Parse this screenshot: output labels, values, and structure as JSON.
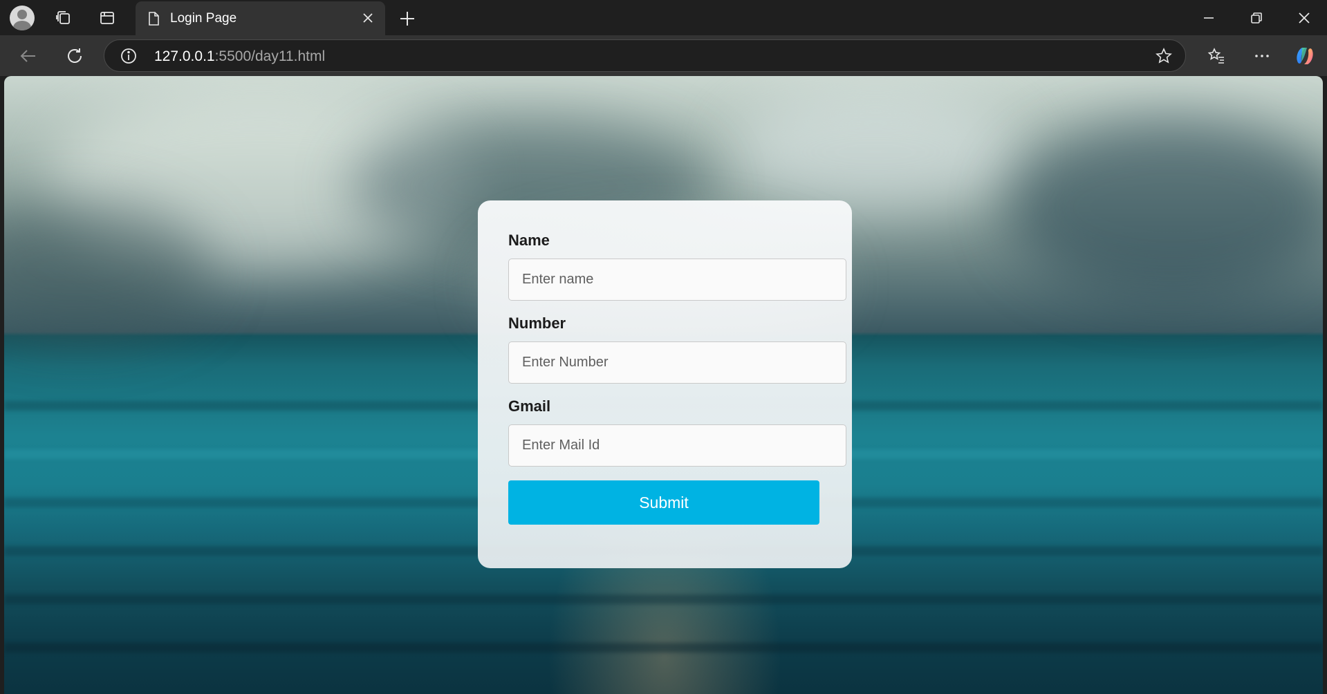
{
  "browser": {
    "tab": {
      "title": "Login Page"
    },
    "address_bar": {
      "url_host": "127.0.0.1",
      "url_rest": ":5500/day11.html"
    },
    "icons": {
      "profile": "profile-avatar-icon",
      "workspaces": "workspaces-icon",
      "tab_actions": "tab-actions-icon",
      "page": "page-icon",
      "close_tab": "close-icon",
      "new_tab": "plus-icon",
      "minimize": "minimize-icon",
      "restore": "restore-icon",
      "close_window": "close-icon",
      "back": "back-arrow-icon",
      "refresh": "refresh-icon",
      "site_info": "info-icon",
      "favorite": "star-icon",
      "favorites": "favorites-icon",
      "more": "more-icon",
      "copilot": "copilot-icon"
    }
  },
  "form": {
    "name": {
      "label": "Name",
      "placeholder": "Enter name",
      "value": ""
    },
    "number": {
      "label": "Number",
      "placeholder": "Enter Number",
      "value": ""
    },
    "gmail": {
      "label": "Gmail",
      "placeholder": "Enter Mail Id",
      "value": ""
    },
    "submit_label": "Submit"
  },
  "colors": {
    "accent": "#00b3e3",
    "chrome_dark": "#1f1f1f",
    "chrome_mid": "#333333"
  }
}
